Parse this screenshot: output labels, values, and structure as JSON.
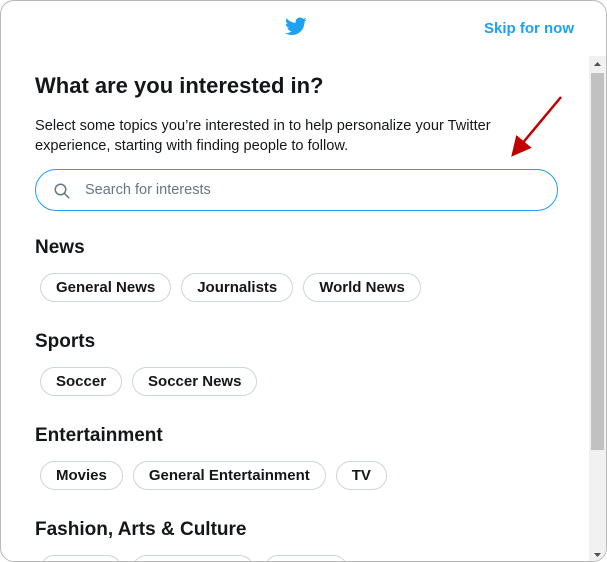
{
  "header": {
    "logo_icon": "twitter-bird-icon",
    "skip_label": "Skip for now",
    "brand_color": "#1da1f2"
  },
  "main": {
    "title": "What are you interested in?",
    "subtitle": "Select some topics you’re interested in to help personalize your Twitter experience, starting with finding people to follow.",
    "search": {
      "placeholder": "Search for interests",
      "value": ""
    },
    "sections": [
      {
        "title": "News",
        "chips": [
          "General News",
          "Journalists",
          "World News"
        ]
      },
      {
        "title": "Sports",
        "chips": [
          "Soccer",
          "Soccer News"
        ]
      },
      {
        "title": "Entertainment",
        "chips": [
          "Movies",
          "General Entertainment",
          "TV"
        ]
      },
      {
        "title": "Fashion, Arts & Culture",
        "chips": [
          "",
          "",
          ""
        ]
      }
    ]
  },
  "annotation": {
    "arrow_color": "#c00000"
  }
}
